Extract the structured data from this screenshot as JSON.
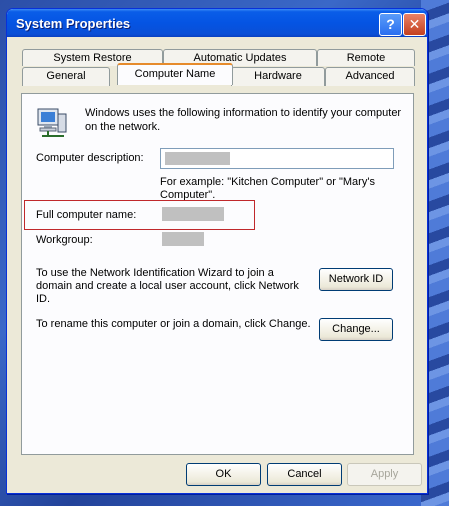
{
  "window": {
    "title": "System Properties"
  },
  "titlebar": {
    "help_glyph": "?",
    "close_glyph": "✕"
  },
  "tabs": {
    "row1": [
      "System Restore",
      "Automatic Updates",
      "Remote"
    ],
    "row2": [
      "General",
      "Computer Name",
      "Hardware",
      "Advanced"
    ],
    "active": "Computer Name"
  },
  "panel": {
    "intro": "Windows uses the following information to identify your computer on the network.",
    "description_label": "Computer description:",
    "description_value": "",
    "example_text": "For example: \"Kitchen Computer\" or \"Mary's Computer\".",
    "full_name_label": "Full computer name:",
    "full_name_value": "",
    "workgroup_label": "Workgroup:",
    "workgroup_value": "",
    "network_id_text": "To use the Network Identification Wizard to join a domain and create a local user account, click Network ID.",
    "network_id_button": "Network ID",
    "change_text": "To rename this computer or join a domain, click Change.",
    "change_button": "Change..."
  },
  "footer": {
    "ok": "OK",
    "cancel": "Cancel",
    "apply": "Apply"
  },
  "icons": {
    "computer": "computer-network-icon"
  }
}
